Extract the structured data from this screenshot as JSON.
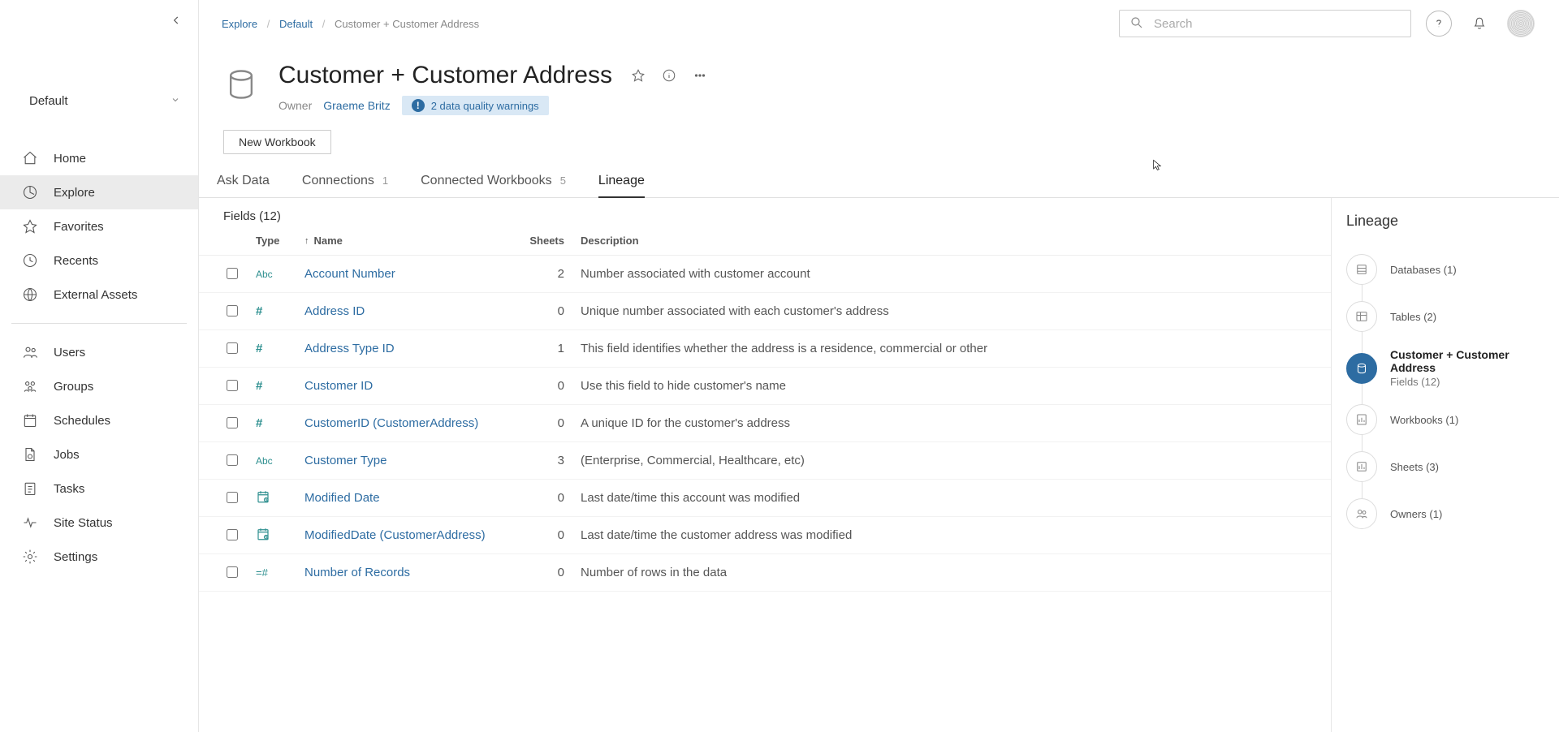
{
  "sidebar": {
    "project": "Default",
    "items": [
      {
        "label": "Home"
      },
      {
        "label": "Explore"
      },
      {
        "label": "Favorites"
      },
      {
        "label": "Recents"
      },
      {
        "label": "External Assets"
      }
    ],
    "admin_items": [
      {
        "label": "Users"
      },
      {
        "label": "Groups"
      },
      {
        "label": "Schedules"
      },
      {
        "label": "Jobs"
      },
      {
        "label": "Tasks"
      },
      {
        "label": "Site Status"
      },
      {
        "label": "Settings"
      }
    ]
  },
  "breadcrumb": {
    "root": "Explore",
    "project": "Default",
    "current": "Customer + Customer Address"
  },
  "search": {
    "placeholder": "Search"
  },
  "header": {
    "title": "Customer + Customer Address",
    "owner_label": "Owner",
    "owner_name": "Graeme Britz",
    "warning_text": "2 data quality warnings"
  },
  "actions": {
    "new_workbook": "New Workbook"
  },
  "tabs": {
    "ask_data": "Ask Data",
    "connections": "Connections",
    "connections_count": "1",
    "connected_wb": "Connected Workbooks",
    "connected_wb_count": "5",
    "lineage": "Lineage"
  },
  "fields": {
    "heading": "Fields (12)",
    "columns": {
      "type": "Type",
      "name": "Name",
      "sheets": "Sheets",
      "desc": "Description"
    },
    "rows": [
      {
        "type": "Abc",
        "name": "Account Number",
        "sheets": "2",
        "desc": "Number associated with customer account"
      },
      {
        "type": "#",
        "name": "Address ID",
        "sheets": "0",
        "desc": "Unique number associated with each customer's address"
      },
      {
        "type": "#",
        "name": "Address Type ID",
        "sheets": "1",
        "desc": "This field identifies whether the address is a residence, commercial or other"
      },
      {
        "type": "#",
        "name": "Customer ID",
        "sheets": "0",
        "desc": "Use this field to hide customer's name"
      },
      {
        "type": "#",
        "name": "CustomerID (CustomerAddress)",
        "sheets": "0",
        "desc": "A unique ID for the customer's address"
      },
      {
        "type": "Abc",
        "name": "Customer Type",
        "sheets": "3",
        "desc": "(Enterprise, Commercial, Healthcare, etc)"
      },
      {
        "type": "date",
        "name": "Modified Date",
        "sheets": "0",
        "desc": "Last date/time this account was modified"
      },
      {
        "type": "date",
        "name": "ModifiedDate (CustomerAddress)",
        "sheets": "0",
        "desc": "Last date/time the customer address was modified"
      },
      {
        "type": "calc",
        "name": "Number of Records",
        "sheets": "0",
        "desc": "Number of rows in the data"
      }
    ]
  },
  "lineage": {
    "title": "Lineage",
    "items": [
      {
        "label": "Databases (1)",
        "icon": "db"
      },
      {
        "label": "Tables (2)",
        "icon": "table"
      },
      {
        "main": "Customer + Customer Address",
        "sub": "Fields (12)",
        "icon": "ds",
        "active": true
      },
      {
        "label": "Workbooks (1)",
        "icon": "wb"
      },
      {
        "label": "Sheets (3)",
        "icon": "sheet"
      },
      {
        "label": "Owners (1)",
        "icon": "owner"
      }
    ]
  }
}
